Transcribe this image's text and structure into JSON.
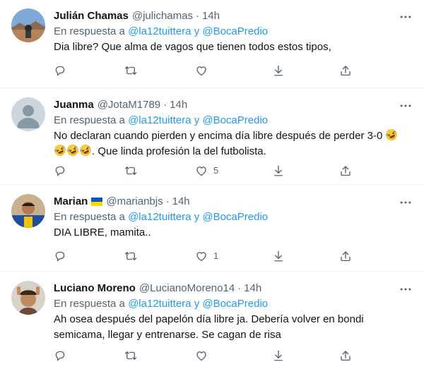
{
  "tweets": [
    {
      "name": "Julián Chamas",
      "handle": "@julichamas",
      "dot": "·",
      "time": "14h",
      "reply_prefix": "En respuesta a",
      "reply_mentions": "@la12tuittera y @BocaPredio",
      "text_line1": "Dia libre? Que alma de vagos que tienen todos estos tipos,",
      "likes": ""
    },
    {
      "name": "Juanma",
      "handle": "@JotaM1789",
      "dot": "·",
      "time": "14h",
      "reply_prefix": "En respuesta a",
      "reply_mentions": "@la12tuittera y @BocaPredio",
      "text_line1": "No declaran cuando pierden y encima día libre después de perder 3-0",
      "text_line2": ". Que linda profesión la del futbolista.",
      "likes": "5"
    },
    {
      "name": "Marian",
      "handle": "@marianbjs",
      "dot": "·",
      "time": "14h",
      "reply_prefix": "En respuesta a",
      "reply_mentions": "@la12tuittera y @BocaPredio",
      "text_line1": "DIA LIBRE, mamita..",
      "likes": "1"
    },
    {
      "name": "Luciano Moreno",
      "handle": "@LucianoMoreno14",
      "dot": "·",
      "time": "14h",
      "reply_prefix": "En respuesta a",
      "reply_mentions": "@la12tuittera y @BocaPredio",
      "text_line1": "Ah osea después del papelón día libre ja. Debería volver en bondi",
      "text_line2": "semicama, llegar y entrenarse. Se cagan de risa",
      "likes": ""
    }
  ],
  "colors": {
    "text": "#0f1419",
    "secondary": "#536471",
    "link": "#1d9bf0",
    "divider": "#eff3f4"
  },
  "icons": [
    "reply-icon",
    "retweet-icon",
    "like-icon",
    "share-down-icon",
    "share-up-icon",
    "more-icon",
    "rofl-emoji"
  ]
}
